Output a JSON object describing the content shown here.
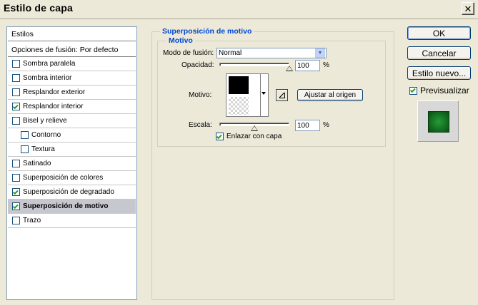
{
  "window": {
    "title": "Estilo de capa",
    "close_glyph": "✕"
  },
  "styles_panel": {
    "header": "Estilos",
    "blend_options": "Opciones de fusión: Por defecto",
    "items": [
      {
        "label": "Sombra paralela",
        "checked": false,
        "indent": false
      },
      {
        "label": "Sombra interior",
        "checked": false,
        "indent": false
      },
      {
        "label": "Resplandor exterior",
        "checked": false,
        "indent": false
      },
      {
        "label": "Resplandor interior",
        "checked": true,
        "indent": false
      },
      {
        "label": "Bisel y relieve",
        "checked": false,
        "indent": false
      },
      {
        "label": "Contorno",
        "checked": false,
        "indent": true
      },
      {
        "label": "Textura",
        "checked": false,
        "indent": true
      },
      {
        "label": "Satinado",
        "checked": false,
        "indent": false
      },
      {
        "label": "Superposición de colores",
        "checked": false,
        "indent": false
      },
      {
        "label": "Superposición de degradado",
        "checked": true,
        "indent": false
      },
      {
        "label": "Superposición de motivo",
        "checked": true,
        "indent": false,
        "selected": true
      },
      {
        "label": "Trazo",
        "checked": false,
        "indent": false
      }
    ]
  },
  "pattern_overlay": {
    "group_title": "Superposición de motivo",
    "subgroup_title": "Motivo",
    "blend_mode_label": "Modo de fusión:",
    "blend_mode_value": "Normal",
    "opacity_label": "Opacidad:",
    "opacity_value": "100",
    "opacity_unit": "%",
    "opacity_fraction": 1.0,
    "pattern_label": "Motivo:",
    "snap_button": "Ajustar al origen",
    "scale_label": "Escala:",
    "scale_value": "100",
    "scale_unit": "%",
    "link_label": "Enlazar con capa",
    "link_checked": true
  },
  "actions": {
    "ok": "OK",
    "cancel": "Cancelar",
    "new_style": "Estilo nuevo...",
    "preview_label": "Previsualizar",
    "preview_checked": true
  },
  "colors": {
    "accent_blue": "#0046d5",
    "check_green": "#21a121",
    "preview_green": "#167a26"
  }
}
